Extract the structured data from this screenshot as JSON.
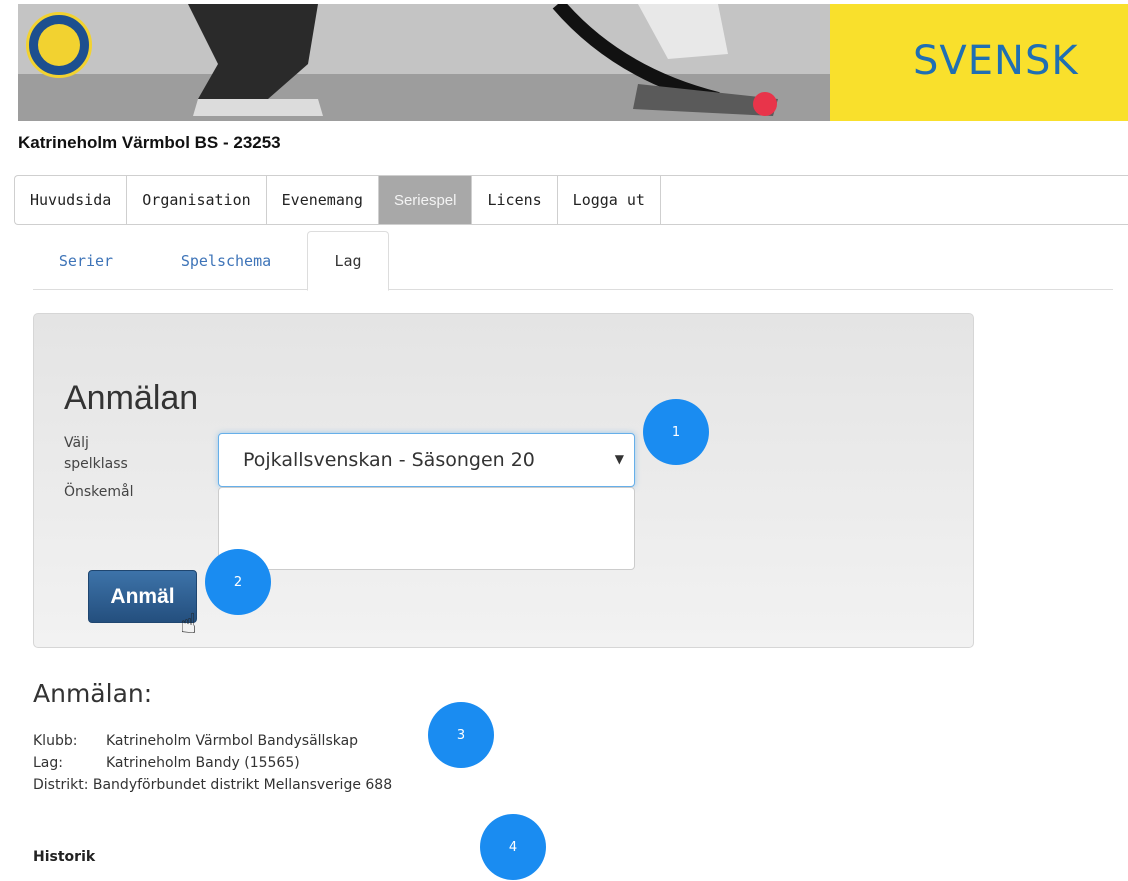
{
  "banner": {
    "brand_text": "SVENSK"
  },
  "page": {
    "club_title": "Katrineholm Värmbol BS - 23253"
  },
  "main_nav": {
    "items": [
      {
        "label": "Huvudsida"
      },
      {
        "label": "Organisation"
      },
      {
        "label": "Evenemang"
      },
      {
        "label": "Seriespel",
        "active": true
      },
      {
        "label": "Licens"
      },
      {
        "label": "Logga ut"
      }
    ]
  },
  "sub_tabs": {
    "items": [
      {
        "label": "Serier"
      },
      {
        "label": "Spelschema"
      },
      {
        "label": "Lag",
        "active": true
      }
    ]
  },
  "form": {
    "title": "Anmälan",
    "class_label": "Välj spelklass",
    "class_value": "Pojkallsvenskan - Säsongen 20",
    "wish_label": "Önskemål",
    "wish_value": "",
    "submit_label": "Anmäl"
  },
  "markers": [
    "1",
    "2",
    "3",
    "4"
  ],
  "summary": {
    "title": "Anmälan:",
    "rows": [
      {
        "key": "Klubb:",
        "value": "Katrineholm Värmbol Bandysällskap"
      },
      {
        "key": "Lag:",
        "value": "Katrineholm Bandy (15565)"
      },
      {
        "key": "Distrikt:",
        "value": "Bandyförbundet distrikt Mellansverige 688"
      }
    ],
    "history_label": "Historik"
  },
  "colors": {
    "accent": "#1a8cf1",
    "button": "#2c5d90",
    "banner_yellow": "#f9e02c",
    "brand_blue": "#1f6fb3"
  }
}
